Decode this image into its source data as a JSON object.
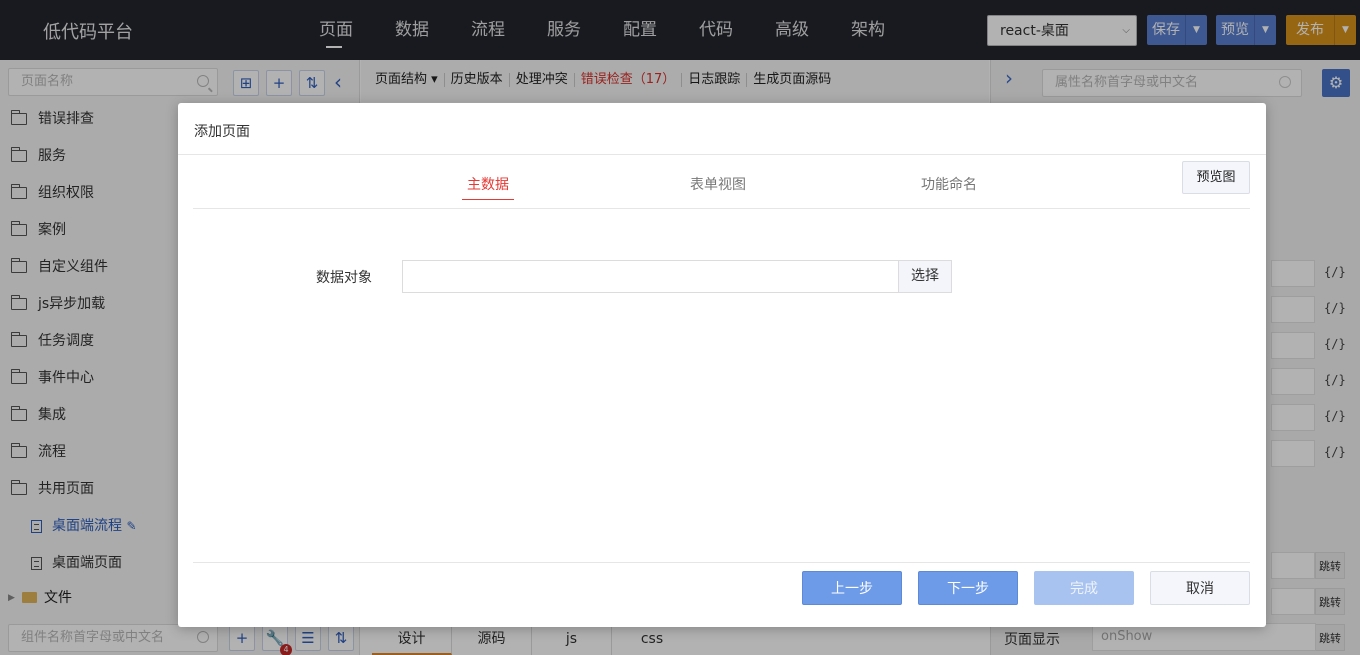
{
  "app": {
    "title": "低代码平台"
  },
  "topnav": {
    "items": [
      "页面",
      "数据",
      "流程",
      "服务",
      "配置",
      "代码",
      "高级",
      "架构"
    ],
    "active": "页面"
  },
  "platform_select": {
    "value": "react-桌面"
  },
  "actions": {
    "save": "保存",
    "preview": "预览",
    "publish": "发布"
  },
  "left_panel": {
    "search_placeholder": "页面名称",
    "tree": [
      {
        "label": "错误排查",
        "type": "folder"
      },
      {
        "label": "服务",
        "type": "folder"
      },
      {
        "label": "组织权限",
        "type": "folder"
      },
      {
        "label": "案例",
        "type": "folder"
      },
      {
        "label": "自定义组件",
        "type": "folder"
      },
      {
        "label": "js异步加载",
        "type": "folder"
      },
      {
        "label": "任务调度",
        "type": "folder"
      },
      {
        "label": "事件中心",
        "type": "folder"
      },
      {
        "label": "集成",
        "type": "folder"
      },
      {
        "label": "流程",
        "type": "folder"
      },
      {
        "label": "共用页面",
        "type": "folder"
      },
      {
        "label": "桌面端流程",
        "type": "page"
      },
      {
        "label": "桌面端页面",
        "type": "page"
      }
    ],
    "file_label": "文件",
    "component_search_placeholder": "组件名称首字母或中文名",
    "badge_count": "4"
  },
  "center_toolbar": {
    "tabs": [
      "页面结构 ▾",
      "历史版本",
      "处理冲突",
      "错误检查（17）",
      "日志跟踪",
      "生成页面源码"
    ]
  },
  "bottom_tabs": [
    "设计",
    "源码",
    "js",
    "css"
  ],
  "right_panel": {
    "search_placeholder": "属性名称首字母或中文名",
    "code_marker": "{/}",
    "jump_label": "跳转",
    "page_show_label": "页面显示",
    "page_show_value": "onShow"
  },
  "modal": {
    "title": "添加页面",
    "steps": [
      "主数据",
      "表单视图",
      "功能命名"
    ],
    "active_step": "主数据",
    "preview_button": "预览图",
    "field_label": "数据对象",
    "field_value": "",
    "pick_button": "选择",
    "buttons": {
      "prev": "上一步",
      "next": "下一步",
      "finish": "完成",
      "cancel": "取消"
    }
  },
  "colors": {
    "topbar_bg": "#23262e",
    "accent_blue": "#5a7ed2",
    "publish_orange": "#d8931a",
    "active_step_red": "#e53935",
    "error_red": "#d9322b"
  }
}
